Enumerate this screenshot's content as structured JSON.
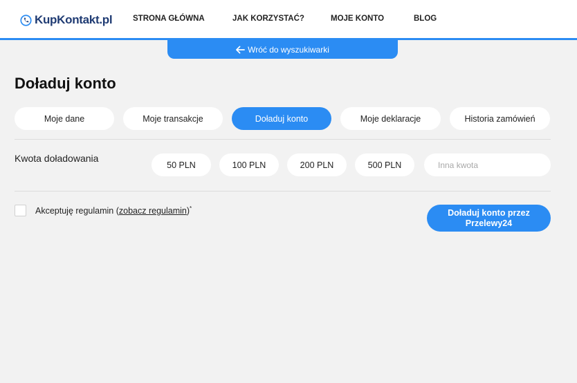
{
  "header": {
    "logo_text": "KupKontakt.pl",
    "nav": [
      {
        "label": "STRONA GŁÓWNA"
      },
      {
        "label": "JAK KORZYSTAĆ?"
      },
      {
        "label": "MOJE KONTO"
      },
      {
        "label": "BLOG"
      }
    ]
  },
  "back_link": {
    "label": "Wróć do wyszukiwarki"
  },
  "page_title": "Doładuj konto",
  "tabs": [
    {
      "label": "Moje dane",
      "active": false
    },
    {
      "label": "Moje transakcje",
      "active": false
    },
    {
      "label": "Doładuj konto",
      "active": true
    },
    {
      "label": "Moje deklaracje",
      "active": false
    },
    {
      "label": "Historia zamówień",
      "active": false
    }
  ],
  "amount": {
    "label": "Kwota doładowania",
    "options": [
      "50 PLN",
      "100 PLN",
      "200 PLN",
      "500 PLN"
    ],
    "custom_placeholder": "Inna kwota",
    "custom_value": ""
  },
  "terms": {
    "prefix": "Akceptuję regulamin (",
    "link": "zobacz regulamin",
    "suffix": ")",
    "required_mark": "*",
    "checked": false
  },
  "submit": {
    "label": "Doładuj konto przez Przelewy24"
  },
  "colors": {
    "accent": "#2b8cf3",
    "background": "#f2f2f2",
    "logo": "#1f3b73"
  }
}
